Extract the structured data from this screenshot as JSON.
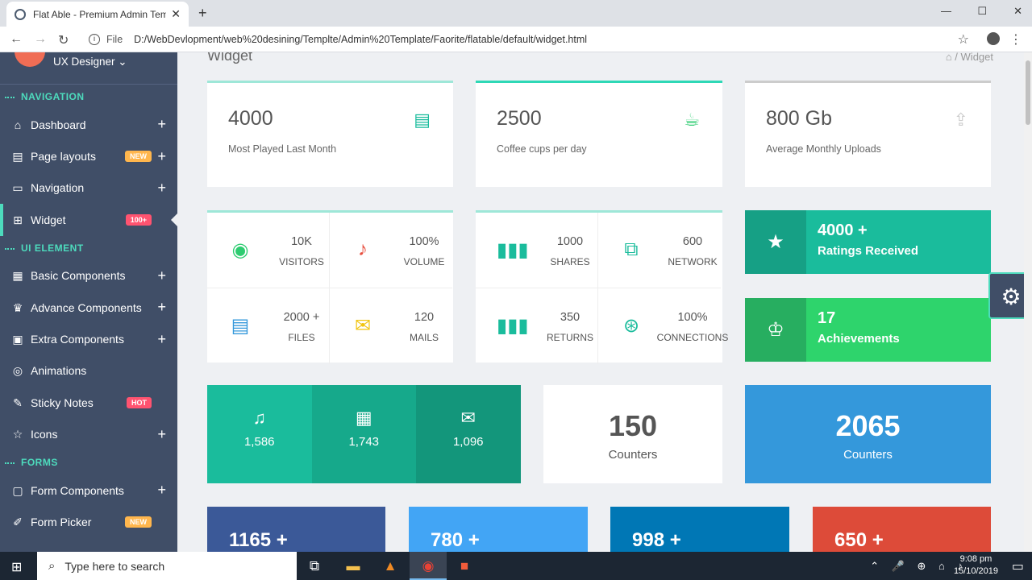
{
  "browser": {
    "tab_title": "Flat Able - Premium Admin Temp",
    "close": "✕",
    "new_tab": "+",
    "win_min": "—",
    "win_max": "☐",
    "win_close": "✕",
    "file_label": "File",
    "url": "D:/WebDevlopment/web%20desining/Templte/Admin%20Template/Faorite/flatable/default/widget.html"
  },
  "sidebar": {
    "user_name": "UX Designer",
    "sections": {
      "navigation": "NAVIGATION",
      "ui": "UI ELEMENT",
      "forms": "FORMS"
    },
    "items": [
      {
        "label": "Dashboard",
        "icon": "home-icon"
      },
      {
        "label": "Page layouts",
        "icon": "layout-icon",
        "badge": "NEW"
      },
      {
        "label": "Navigation",
        "icon": "monitor-icon"
      },
      {
        "label": "Widget",
        "icon": "grid-icon",
        "badge": "100+"
      },
      {
        "label": "Basic Components",
        "icon": "box-icon"
      },
      {
        "label": "Advance Components",
        "icon": "crown-icon"
      },
      {
        "label": "Extra Components",
        "icon": "modules-icon"
      },
      {
        "label": "Animations",
        "icon": "aperture-icon"
      },
      {
        "label": "Sticky Notes",
        "icon": "note-icon",
        "badge": "HOT"
      },
      {
        "label": "Icons",
        "icon": "star-icon"
      },
      {
        "label": "Form Components",
        "icon": "form-icon"
      },
      {
        "label": "Form Picker",
        "icon": "edit-icon",
        "badge": "NEW"
      }
    ]
  },
  "page": {
    "title": "Widget",
    "breadcrumb": "Widget"
  },
  "top_cards": [
    {
      "value": "4000",
      "label": "Most Played Last Month",
      "icon": "comment-icon",
      "color": "#1abc9c"
    },
    {
      "value": "2500",
      "label": "Coffee cups per day",
      "icon": "coffee-icon",
      "color": "#2ed8b6"
    },
    {
      "value": "800 Gb",
      "label": "Average Monthly Uploads",
      "icon": "upload-icon",
      "color": "#ccc"
    }
  ],
  "mini_stats": [
    {
      "value": "10K",
      "label": "VISITORS",
      "icon": "eye-icon"
    },
    {
      "value": "100%",
      "label": "VOLUME",
      "icon": "music-icon"
    },
    {
      "value": "2000 +",
      "label": "FILES",
      "icon": "files-icon"
    },
    {
      "value": "120",
      "label": "MAILS",
      "icon": "mail-icon"
    },
    {
      "value": "1000",
      "label": "SHARES",
      "icon": "bars-icon"
    },
    {
      "value": "600",
      "label": "NETWORK",
      "icon": "network-icon"
    },
    {
      "value": "350",
      "label": "RETURNS",
      "icon": "bars-icon"
    },
    {
      "value": "100%",
      "label": "CONNECTIONS",
      "icon": "antenna-icon"
    }
  ],
  "stat_cards": [
    {
      "value": "4000 +",
      "label": "Ratings Received",
      "icon": "star-icon"
    },
    {
      "value": "17",
      "label": "Achievements",
      "icon": "trophy-icon"
    }
  ],
  "segments": [
    {
      "value": "1,586",
      "icon": "music-icon"
    },
    {
      "value": "1,743",
      "icon": "film-icon"
    },
    {
      "value": "1,096",
      "icon": "envelope-icon"
    }
  ],
  "counters": [
    {
      "value": "150",
      "label": "Counters"
    },
    {
      "value": "2065",
      "label": "Counters"
    }
  ],
  "social": [
    "1165 +",
    "780 +",
    "998 +",
    "650 +"
  ],
  "taskbar": {
    "search_placeholder": "Type here to search",
    "time": "9:08 pm",
    "date": "15/10/2019"
  }
}
